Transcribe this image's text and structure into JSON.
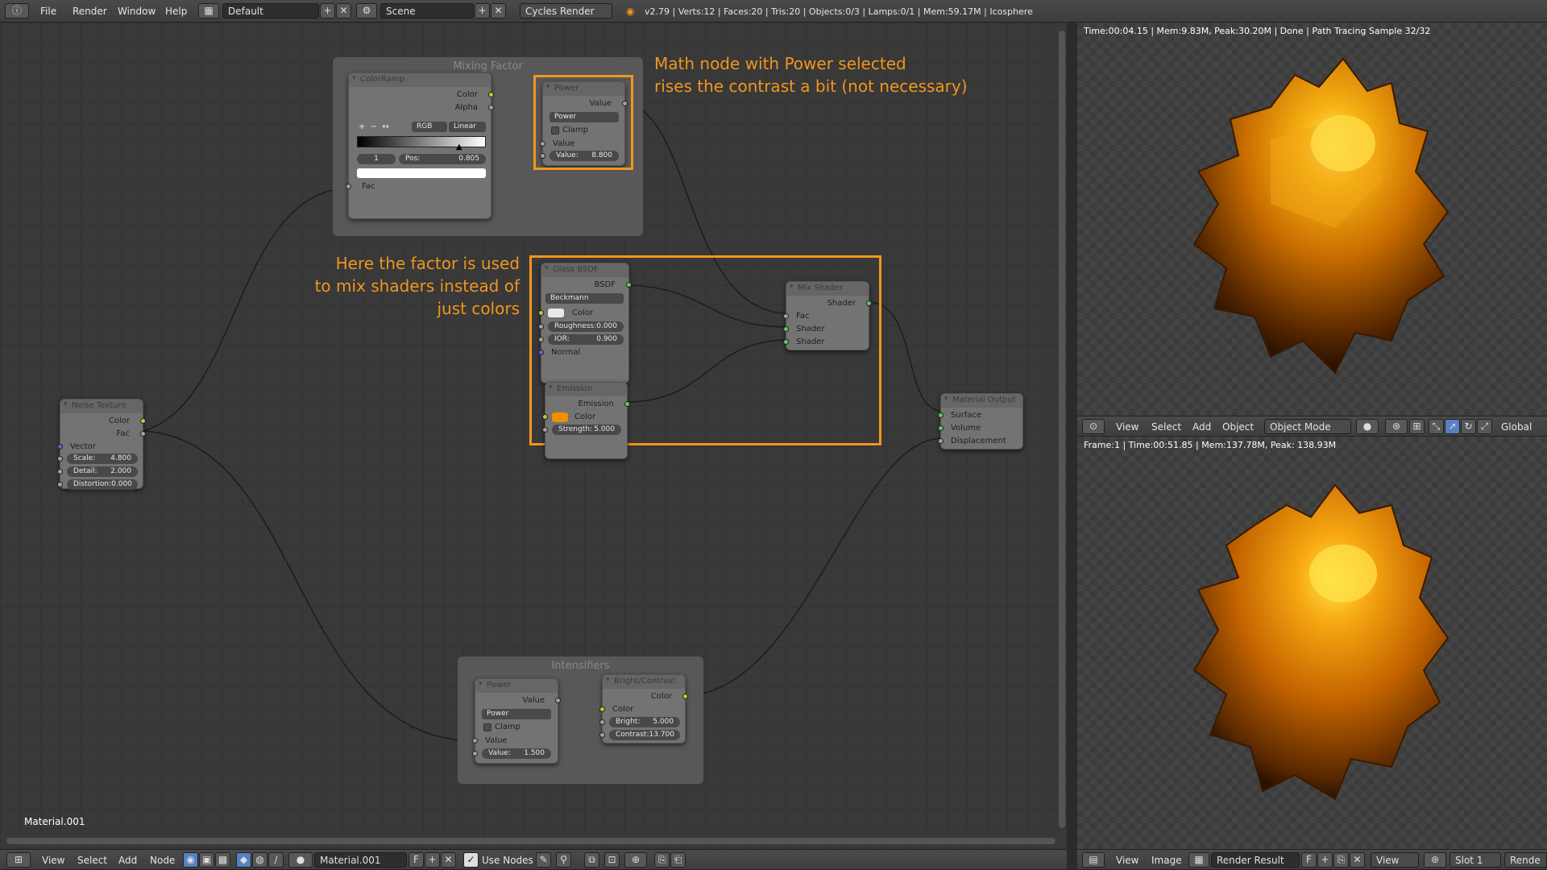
{
  "topbar": {
    "menu": [
      "File",
      "Render",
      "Window",
      "Help"
    ],
    "layout": "Default",
    "scene": "Scene",
    "engine": "Cycles Render",
    "stats": "v2.79 | Verts:12 | Faces:20 | Tris:20 | Objects:0/3 | Lamps:0/1 | Mem:59.17M | Icosphere"
  },
  "frames": {
    "mixing": "Mixing Factor",
    "intensifiers": "Intensifiers"
  },
  "nodes": {
    "colorramp": {
      "title": "ColorRamp",
      "color": "Color",
      "alpha": "Alpha",
      "mode": "RGB",
      "interp": "Linear",
      "index": "1",
      "pos_label": "Pos:",
      "pos": "0.805",
      "fac": "Fac"
    },
    "power1": {
      "title": "Power",
      "value_out": "Value",
      "op": "Power",
      "clamp": "Clamp",
      "value_in": "Value",
      "value_label": "Value:",
      "value": "8.800"
    },
    "glass": {
      "title": "Glass BSDF",
      "bsdf": "BSDF",
      "dist": "Beckmann",
      "color": "Color",
      "rough_label": "Roughness:",
      "rough": "0.000",
      "ior_label": "IOR:",
      "ior": "0.900",
      "normal": "Normal"
    },
    "emission": {
      "title": "Emission",
      "out": "Emission",
      "color": "Color",
      "str_label": "Strength:",
      "str": "5.000"
    },
    "mix": {
      "title": "Mix Shader",
      "out": "Shader",
      "fac": "Fac",
      "s1": "Shader",
      "s2": "Shader"
    },
    "output": {
      "title": "Material Output",
      "surface": "Surface",
      "volume": "Volume",
      "disp": "Displacement"
    },
    "noise": {
      "title": "Noise Texture",
      "color": "Color",
      "fac": "Fac",
      "vector": "Vector",
      "scale_label": "Scale:",
      "scale": "4.800",
      "detail_label": "Detail:",
      "detail": "2.000",
      "dist_label": "Distortion:",
      "dist": "0.000"
    },
    "power2": {
      "title": "Power",
      "value_out": "Value",
      "op": "Power",
      "clamp": "Clamp",
      "value_in": "Value",
      "value_label": "Value:",
      "value": "1.500"
    },
    "bright": {
      "title": "Bright/Contrast",
      "out": "Color",
      "color": "Color",
      "bright_label": "Bright:",
      "bright": "5.000",
      "contrast_label": "Contrast:",
      "contrast": "13.700"
    }
  },
  "annotations": {
    "power": [
      "Math node with Power selected",
      "rises the contrast a bit (not necessary)"
    ],
    "factor": [
      "Here the factor is used",
      "to mix shaders instead of",
      "just colors"
    ]
  },
  "editor": {
    "material_label": "Material.001",
    "footer": [
      "View",
      "Select",
      "Add",
      "Node"
    ],
    "material": "Material.001",
    "fake_user": "F",
    "use_nodes": "Use Nodes"
  },
  "viewport_top": {
    "stats": "Time:00:04.15 | Mem:9.83M, Peak:30.20M | Done | Path Tracing Sample 32/32",
    "header": [
      "View",
      "Select",
      "Add",
      "Object"
    ],
    "mode": "Object Mode",
    "orientation": "Global"
  },
  "render": {
    "stats": "Frame:1 | Time:00:51.85 | Mem:137.78M, Peak: 138.93M",
    "header": [
      "View",
      "Image"
    ],
    "result": "Render Result",
    "view": "View",
    "slot": "Slot 1",
    "layer": "Rende"
  },
  "colors": {
    "accent": "#f0961e",
    "socket_yellow": "#c7c729",
    "socket_green": "#63c763",
    "render_orange": "#f0a000"
  }
}
